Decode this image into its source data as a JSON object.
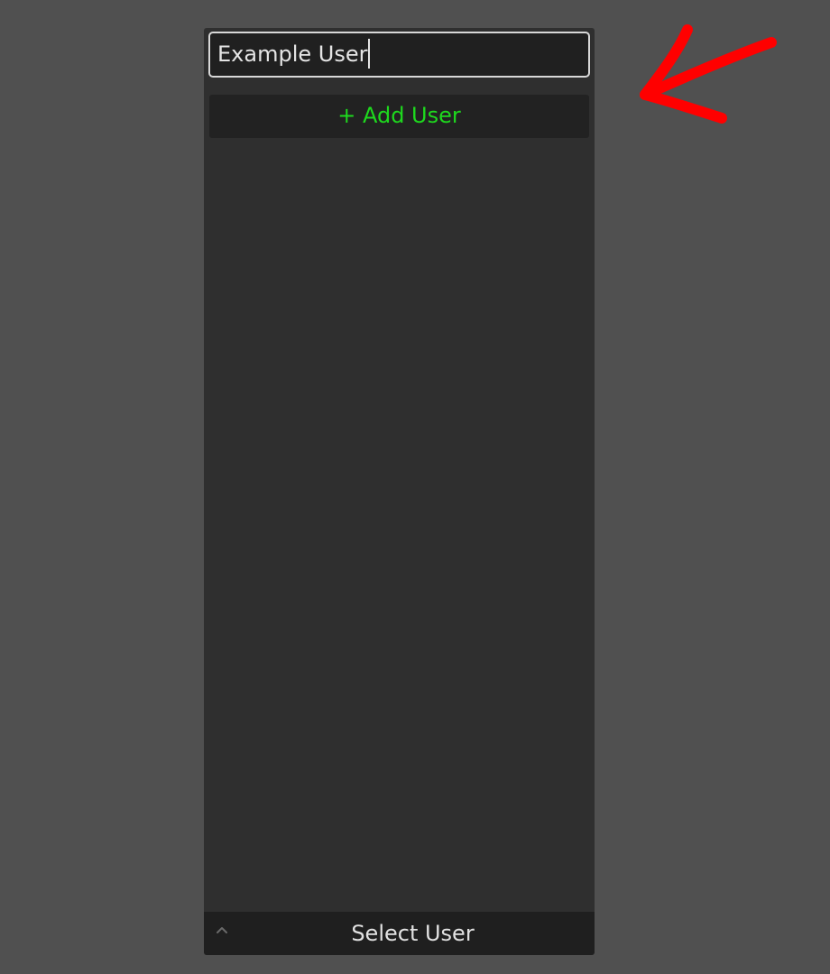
{
  "panel": {
    "name_input": {
      "value": "Example User"
    },
    "add_button": {
      "label": "+ Add User"
    },
    "footer": {
      "label": "Select User",
      "icon": "chevron-up-icon"
    }
  },
  "annotation": {
    "icon": "arrow-icon",
    "color": "#ff0000"
  },
  "colors": {
    "background": "#505050",
    "panel": "#2f2f2f",
    "accent_green": "#1ed91e"
  }
}
